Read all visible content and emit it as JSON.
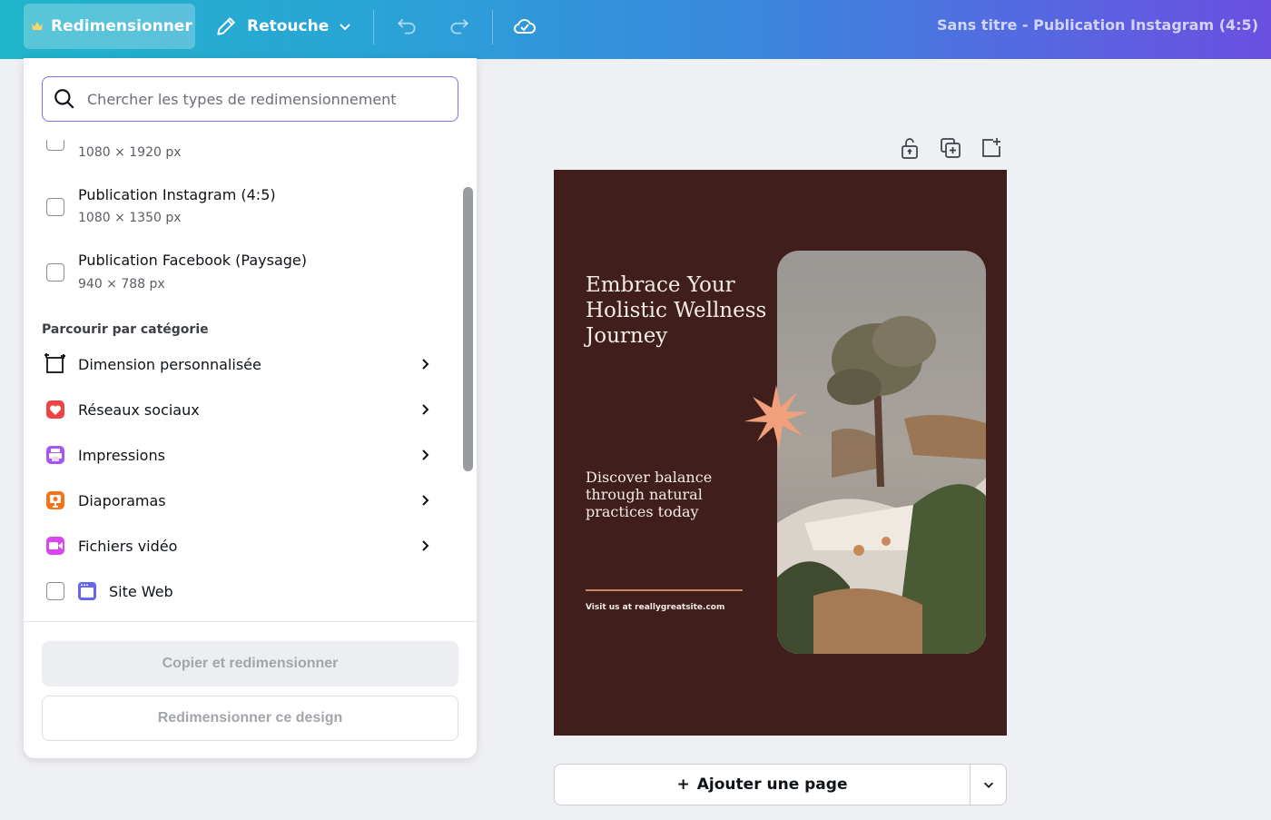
{
  "topbar": {
    "resize_label": "Redimensionner",
    "retouch_label": "Retouche",
    "doc_title": "Sans titre - Publication Instagram (4:5)"
  },
  "panel": {
    "search_placeholder": "Chercher les types de redimensionnement",
    "formats": [
      {
        "title": "",
        "size": "1080 × 1920 px"
      },
      {
        "title": "Publication Instagram (4:5)",
        "size": "1080 × 1350 px"
      },
      {
        "title": "Publication Facebook (Paysage)",
        "size": "940 × 788 px"
      }
    ],
    "category_heading": "Parcourir par catégorie",
    "categories": [
      {
        "label": "Dimension personnalisée",
        "icon": "resize-corners-icon"
      },
      {
        "label": "Réseaux sociaux",
        "icon": "heart-icon",
        "color": "#ef4444"
      },
      {
        "label": "Impressions",
        "icon": "printer-icon",
        "color": "#a855f7"
      },
      {
        "label": "Diaporamas",
        "icon": "presentation-icon",
        "color": "#f97316"
      },
      {
        "label": "Fichiers vidéo",
        "icon": "video-icon",
        "color": "#d946ef"
      }
    ],
    "website": {
      "label": "Site Web",
      "icon": "browser-icon",
      "color": "#6366f1"
    },
    "copy_resize_label": "Copier et redimensionner",
    "resize_design_label": "Redimensionner ce design"
  },
  "design": {
    "title": "Embrace Your Holistic Wellness Journey",
    "subtitle": "Discover balance through natural practices today",
    "url": "Visit us at reallygreatsite.com",
    "bg_color": "#3f1e1c",
    "accent_color": "#f2a07b"
  },
  "add_page_label": "Ajouter une page",
  "add_page_plus": "+"
}
